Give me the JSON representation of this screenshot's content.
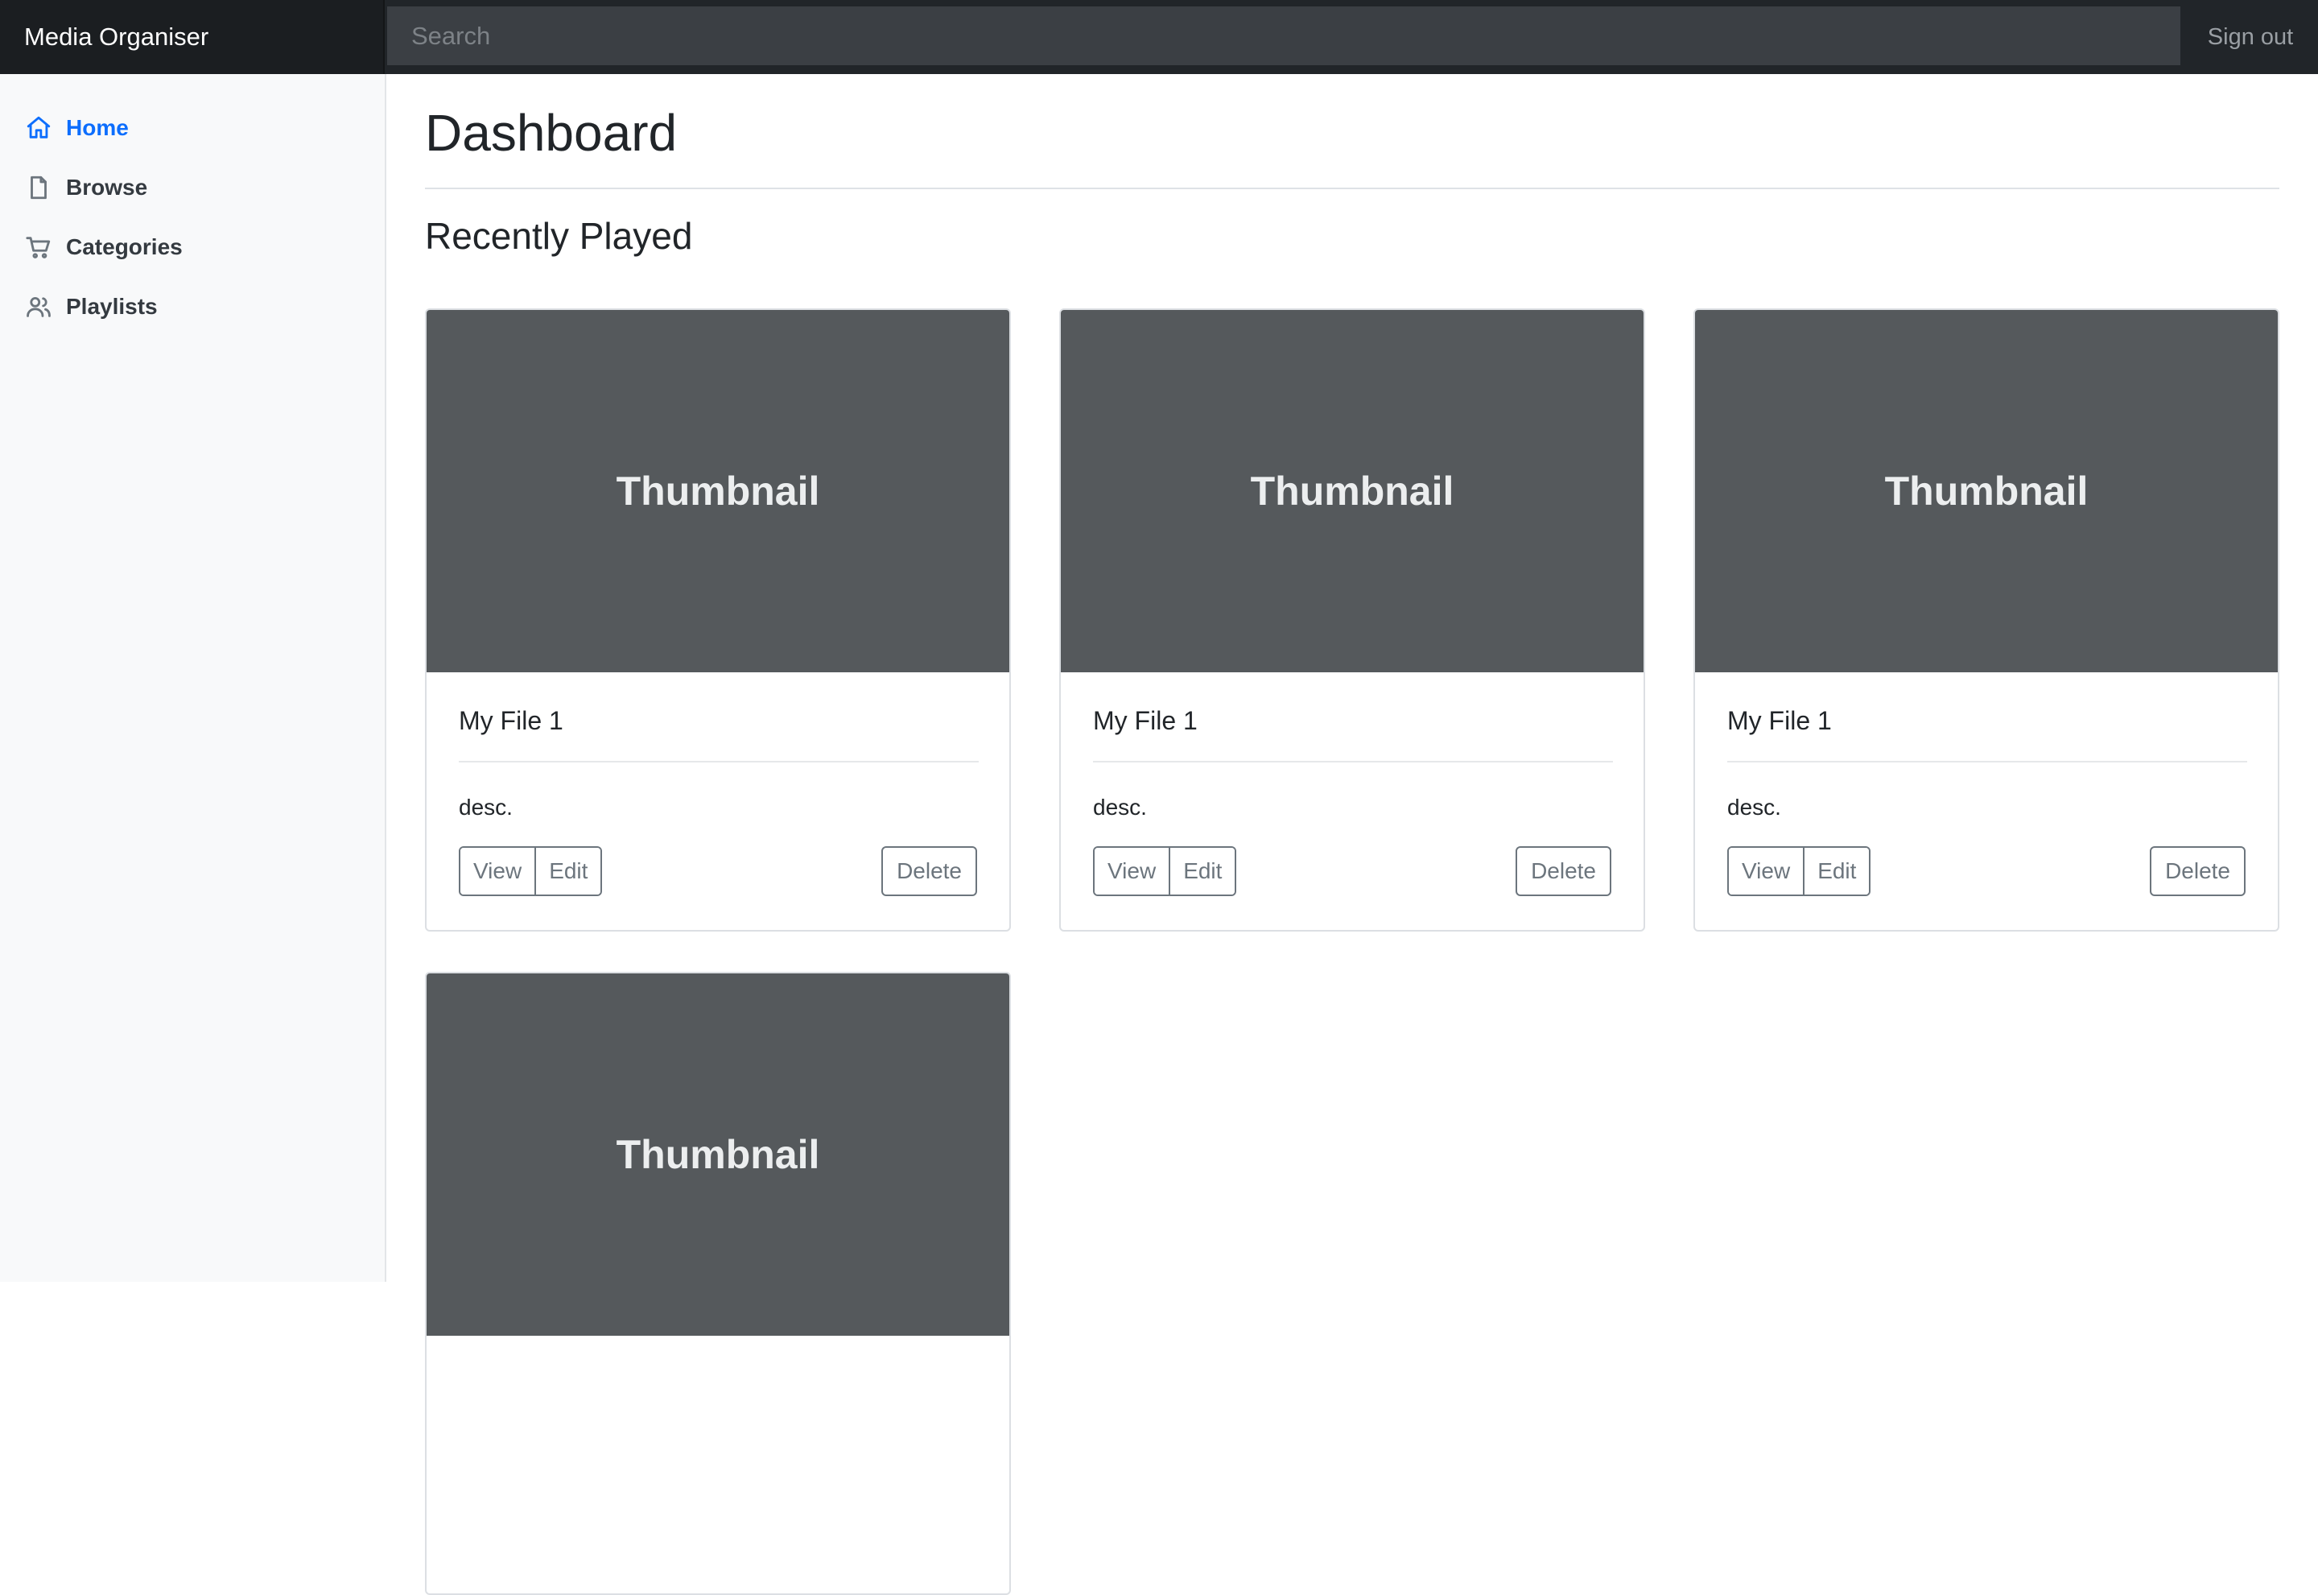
{
  "header": {
    "brand": "Media Organiser",
    "search_placeholder": "Search",
    "signout_label": "Sign out"
  },
  "sidebar": {
    "items": [
      {
        "label": "Home",
        "icon": "home-icon",
        "active": true
      },
      {
        "label": "Browse",
        "icon": "file-icon",
        "active": false
      },
      {
        "label": "Categories",
        "icon": "cart-icon",
        "active": false
      },
      {
        "label": "Playlists",
        "icon": "users-icon",
        "active": false
      }
    ]
  },
  "main": {
    "title": "Dashboard",
    "section_title": "Recently Played",
    "cards": [
      {
        "thumbnail": "Thumbnail",
        "title": "My File 1",
        "desc": "desc.",
        "view_label": "View",
        "edit_label": "Edit",
        "delete_label": "Delete"
      },
      {
        "thumbnail": "Thumbnail",
        "title": "My File 1",
        "desc": "desc.",
        "view_label": "View",
        "edit_label": "Edit",
        "delete_label": "Delete"
      },
      {
        "thumbnail": "Thumbnail",
        "title": "My File 1",
        "desc": "desc.",
        "view_label": "View",
        "edit_label": "Edit",
        "delete_label": "Delete"
      },
      {
        "thumbnail": "Thumbnail"
      }
    ]
  },
  "colors": {
    "navbar_bg": "#212529",
    "accent": "#0d6efd",
    "thumbnail_bg": "#55595c",
    "sidebar_bg": "#f8f9fa",
    "button_outline": "#6c757d"
  }
}
